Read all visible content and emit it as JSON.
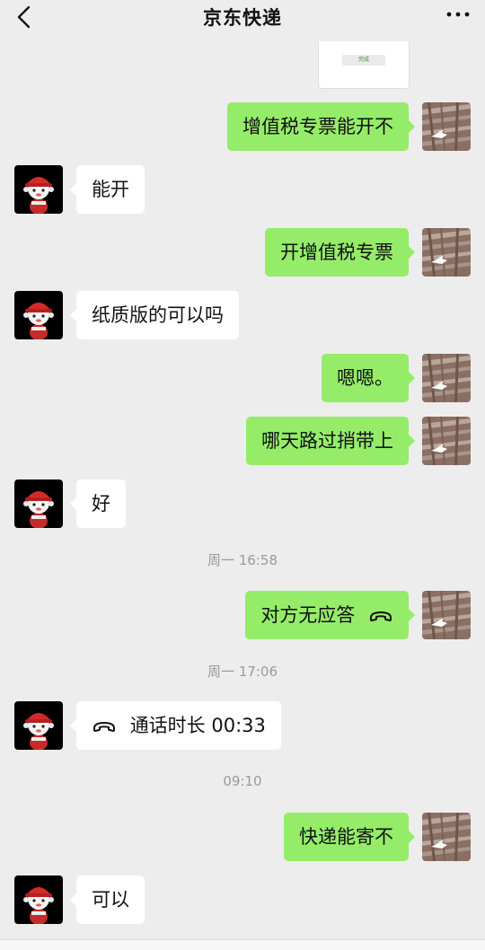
{
  "header": {
    "title": "京东快递",
    "back_icon": "chevron-left-icon",
    "more_icon": "more-dots-icon"
  },
  "image_message": {
    "button_text": "完成"
  },
  "messages": [
    {
      "side": "out",
      "text": "增值税专票能开不"
    },
    {
      "side": "in",
      "text": "能开"
    },
    {
      "side": "out",
      "text": "开增值税专票"
    },
    {
      "side": "in",
      "text": "纸质版的可以吗"
    },
    {
      "side": "out",
      "text": "嗯嗯。"
    },
    {
      "side": "out",
      "text": "哪天路过捎带上"
    },
    {
      "side": "in",
      "text": "好"
    },
    {
      "side": "out",
      "text": "对方无应答",
      "icon": "phone-hangup-icon"
    },
    {
      "side": "in",
      "text": "通话时长 00:33",
      "icon": "phone-hangup-icon"
    },
    {
      "side": "out",
      "text": "快递能寄不"
    },
    {
      "side": "in",
      "text": "可以"
    }
  ],
  "timestamps": [
    "周一 16:58",
    "周一 17:06",
    "09:10"
  ],
  "colors": {
    "background": "#ededed",
    "outgoing_bubble": "#95ec69",
    "incoming_bubble": "#ffffff",
    "timestamp_text": "#9a9a9a"
  }
}
